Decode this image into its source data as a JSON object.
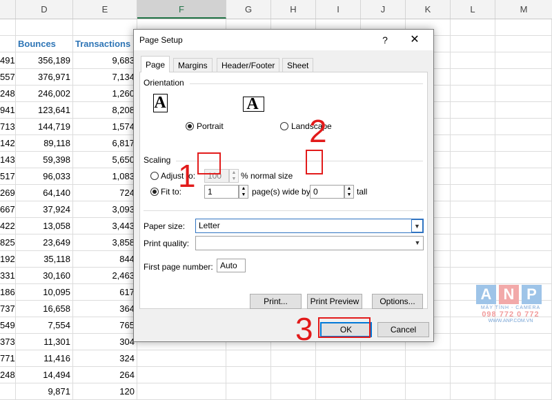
{
  "sheet": {
    "columns": [
      "D",
      "E",
      "F",
      "G",
      "H",
      "I",
      "J",
      "K",
      "L",
      "M"
    ],
    "selected_column": "F",
    "header_row": {
      "d": "Bounces",
      "e": "Transactions"
    },
    "rows": [
      {
        "c": "491",
        "d": "356,189",
        "e": "9,683"
      },
      {
        "c": "557",
        "d": "376,971",
        "e": "7,134"
      },
      {
        "c": "248",
        "d": "246,002",
        "e": "1,260"
      },
      {
        "c": "941",
        "d": "123,641",
        "e": "8,208"
      },
      {
        "c": "713",
        "d": "144,719",
        "e": "1,574"
      },
      {
        "c": "142",
        "d": "89,118",
        "e": "6,817"
      },
      {
        "c": "143",
        "d": "59,398",
        "e": "5,650"
      },
      {
        "c": "517",
        "d": "96,033",
        "e": "1,083"
      },
      {
        "c": "269",
        "d": "64,140",
        "e": "724"
      },
      {
        "c": "667",
        "d": "37,924",
        "e": "3,093"
      },
      {
        "c": "422",
        "d": "13,058",
        "e": "3,443"
      },
      {
        "c": "825",
        "d": "23,649",
        "e": "3,858"
      },
      {
        "c": "192",
        "d": "35,118",
        "e": "844"
      },
      {
        "c": "331",
        "d": "30,160",
        "e": "2,463"
      },
      {
        "c": "186",
        "d": "10,095",
        "e": "617"
      },
      {
        "c": "737",
        "d": "16,658",
        "e": "364"
      },
      {
        "c": "549",
        "d": "7,554",
        "e": "765"
      },
      {
        "c": "373",
        "d": "11,301",
        "e": "304"
      },
      {
        "c": "771",
        "d": "11,416",
        "e": "324"
      },
      {
        "c": "248",
        "d": "14,494",
        "e": "264"
      },
      {
        "c": "",
        "d": "9,871",
        "e": "120"
      }
    ]
  },
  "dialog": {
    "title": "Page Setup",
    "help_label": "?",
    "close_label": "✕",
    "tabs": [
      "Page",
      "Margins",
      "Header/Footer",
      "Sheet"
    ],
    "orientation": {
      "label": "Orientation",
      "portrait": "Portrait",
      "landscape": "Landscape",
      "icon_glyph": "A"
    },
    "scaling": {
      "label": "Scaling",
      "adjust_to": "Adjust to:",
      "adjust_value": "100",
      "normal_size": "% normal size",
      "fit_to": "Fit to:",
      "pages_wide_value": "1",
      "pages_wide_label": "page(s) wide by",
      "tall_value": "0",
      "tall_label": "tall"
    },
    "paper_size_label": "Paper size:",
    "paper_size_value": "Letter",
    "print_quality_label": "Print quality:",
    "print_quality_value": "",
    "first_page_label": "First page number:",
    "first_page_value": "Auto",
    "buttons": {
      "print": "Print...",
      "print_preview": "Print Preview",
      "options": "Options...",
      "ok": "OK",
      "cancel": "Cancel"
    }
  },
  "annotations": {
    "one": "1",
    "two": "2",
    "three": "3"
  },
  "watermark": {
    "letters": [
      "A",
      "N",
      "P"
    ],
    "tagline": "MÁY TÍNH - CAMERA",
    "phone": "098 772 0 772",
    "url": "WWW.ANP.COM.VN"
  }
}
